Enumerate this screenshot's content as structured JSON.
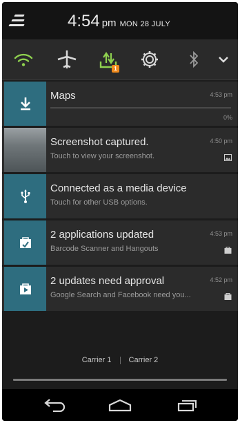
{
  "status": {
    "time": "4:54",
    "ampm": "pm",
    "date": "MON 28 JULY"
  },
  "quick_settings": {
    "accent": "#8fd14f",
    "icons": [
      "wifi-icon",
      "airplane-mode-icon",
      "sync-icon",
      "settings-icon",
      "bluetooth-icon",
      "expand-icon"
    ],
    "sync_badge": "1"
  },
  "notifications": [
    {
      "id": "maps",
      "title": "Maps",
      "time": "4:53 pm",
      "percent": "0%",
      "progress": 0
    },
    {
      "id": "screenshot",
      "title": "Screenshot captured.",
      "subtitle": "Touch to view your screenshot.",
      "time": "4:50 pm"
    },
    {
      "id": "usb",
      "title": "Connected as a media device",
      "subtitle": "Touch for other USB options."
    },
    {
      "id": "updated",
      "title": "2 applications updated",
      "subtitle": "Barcode Scanner and Hangouts",
      "time": "4:53 pm"
    },
    {
      "id": "approval",
      "title": "2 updates need approval",
      "subtitle": "Google Search and Facebook need you...",
      "time": "4:52 pm"
    }
  ],
  "carriers": [
    "Carrier 1",
    "Carrier 2"
  ],
  "colors": {
    "tile": "#2e6d7f",
    "background": "#2b2b2b",
    "progress": "#33b5e5"
  }
}
